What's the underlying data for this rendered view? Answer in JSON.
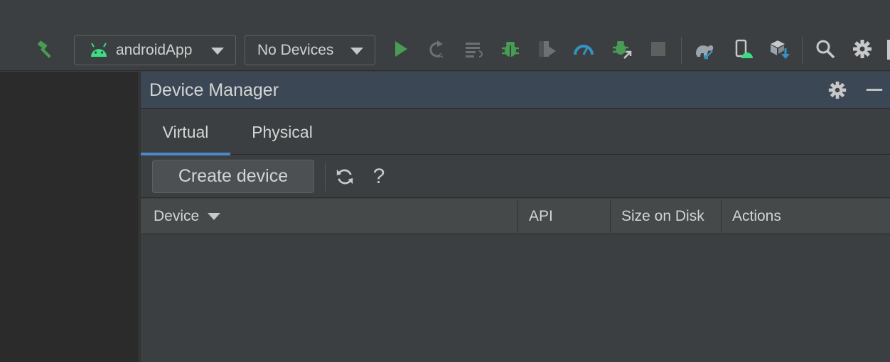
{
  "toolbar": {
    "build_icon": "hammer-icon",
    "config_combo": {
      "label": "androidApp",
      "icon": "android-icon"
    },
    "device_combo": {
      "label": "No Devices"
    },
    "icons": [
      "run-icon",
      "apply-changes-icon",
      "run-logcat-icon",
      "debug-icon",
      "coverage-icon",
      "profile-icon",
      "attach-debugger-icon",
      "stop-icon",
      "gradle-sync-icon",
      "device-manager-icon",
      "sdk-manager-icon",
      "search-icon",
      "settings-icon"
    ]
  },
  "panel": {
    "title": "Device Manager",
    "tabs": [
      {
        "label": "Virtual",
        "active": true
      },
      {
        "label": "Physical",
        "active": false
      }
    ],
    "create_button": "Create device",
    "help": "?",
    "columns": [
      "Device",
      "API",
      "Size on Disk",
      "Actions"
    ]
  },
  "colors": {
    "accent": "#4a88c7",
    "android_green": "#3ddc84",
    "run_green": "#499c54",
    "header_bg": "#3b4754",
    "toolbar_bg": "#3c3f41"
  }
}
